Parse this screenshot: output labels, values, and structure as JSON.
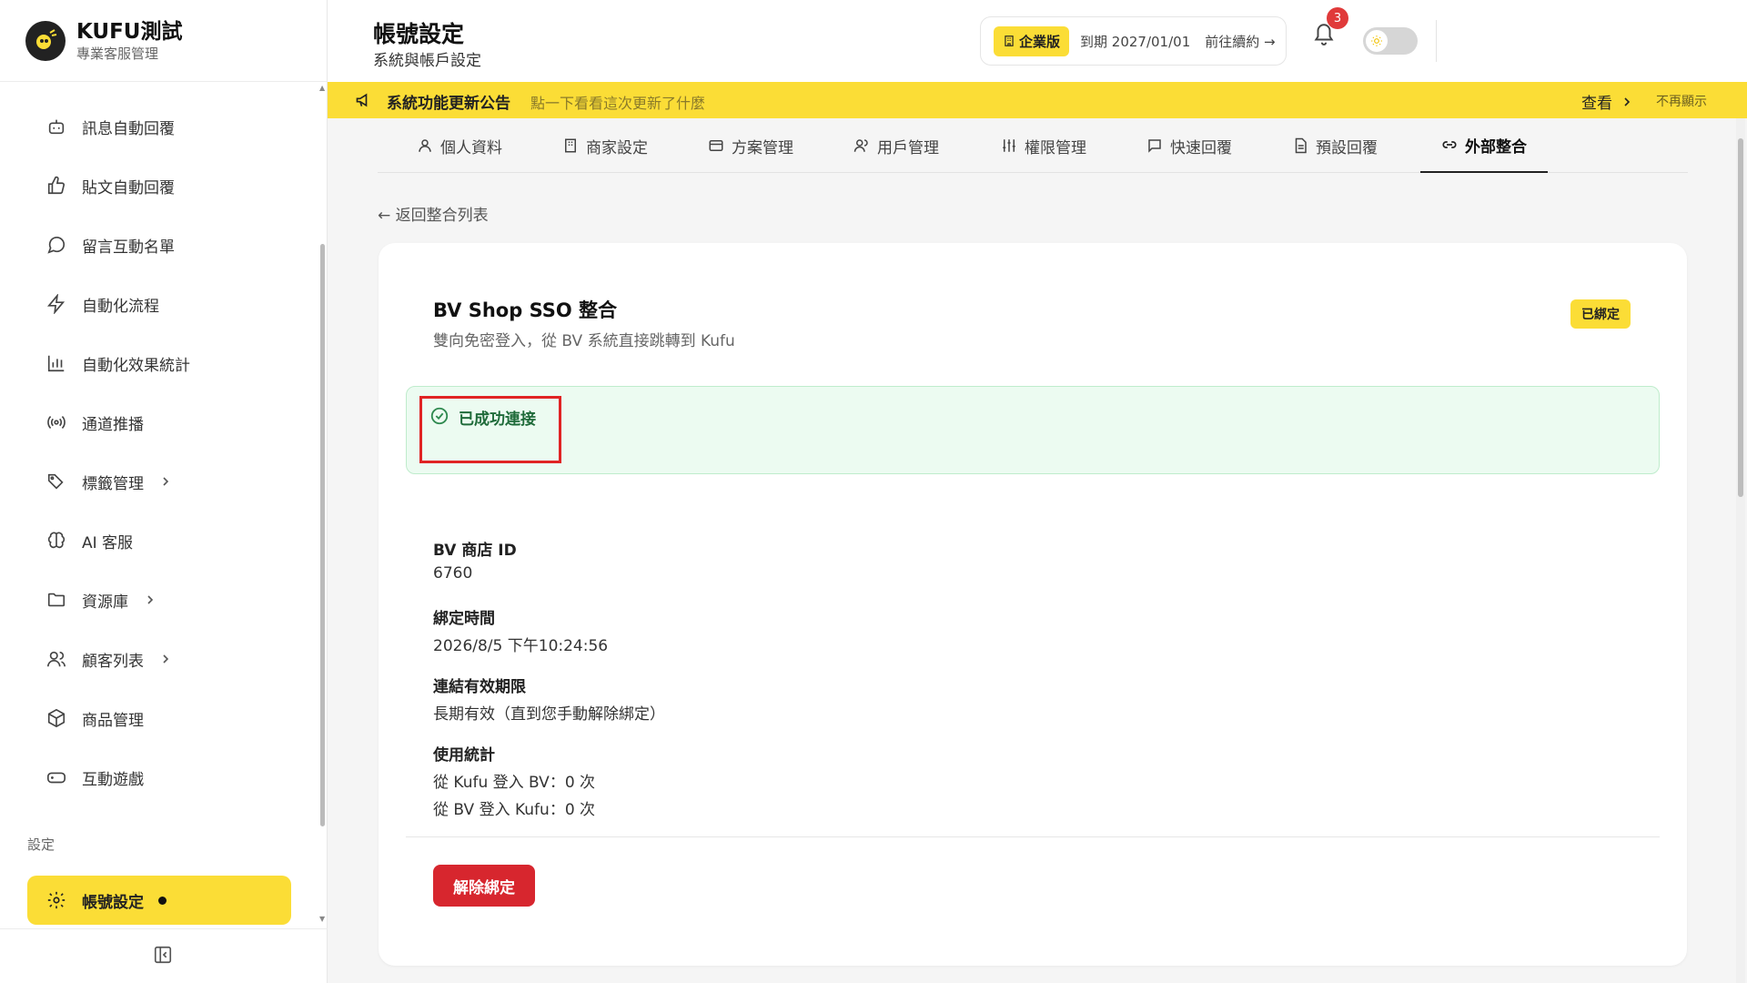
{
  "brand": {
    "name": "KUFU測試",
    "subtitle": "專業客服管理"
  },
  "sidebar": {
    "items": [
      {
        "label": "訊息自動回覆",
        "icon": "bot-icon"
      },
      {
        "label": "貼文自動回覆",
        "icon": "thumbs-up-icon"
      },
      {
        "label": "留言互動名單",
        "icon": "message-circle-icon"
      },
      {
        "label": "自動化流程",
        "icon": "zap-icon"
      },
      {
        "label": "自動化效果統計",
        "icon": "bar-chart-icon"
      },
      {
        "label": "通道推播",
        "icon": "broadcast-icon"
      },
      {
        "label": "標籤管理",
        "icon": "tags-icon"
      },
      {
        "label": "AI 客服",
        "icon": "brain-icon"
      },
      {
        "label": "資源庫",
        "icon": "folder-icon"
      },
      {
        "label": "顧客列表",
        "icon": "users-icon"
      },
      {
        "label": "商品管理",
        "icon": "package-icon"
      },
      {
        "label": "互動遊戲",
        "icon": "gamepad-icon"
      }
    ],
    "section_label": "設定",
    "active_item": "帳號設定"
  },
  "header": {
    "title": "帳號設定",
    "subtitle": "系統與帳戶設定",
    "plan_badge": "企業版",
    "plan_expire": "到期 2027/01/01",
    "plan_renew": "前往續約 →",
    "notification_count": "3"
  },
  "announcement": {
    "title": "系統功能更新公告",
    "text": "點一下看看這次更新了什麼",
    "view": "查看",
    "dismiss": "不再顯示"
  },
  "tabs": [
    {
      "label": "個人資料",
      "icon": "user-icon"
    },
    {
      "label": "商家設定",
      "icon": "building-icon"
    },
    {
      "label": "方案管理",
      "icon": "credit-card-icon"
    },
    {
      "label": "用戶管理",
      "icon": "users-icon"
    },
    {
      "label": "權限管理",
      "icon": "sliders-icon"
    },
    {
      "label": "快速回覆",
      "icon": "message-square-icon"
    },
    {
      "label": "預設回覆",
      "icon": "file-text-icon"
    },
    {
      "label": "外部整合",
      "icon": "link-icon"
    }
  ],
  "back_link": "← 返回整合列表",
  "card": {
    "title": "BV Shop SSO 整合",
    "description": "雙向免密登入，從 BV 系統直接跳轉到 Kufu",
    "badge": "已綁定",
    "status": "已成功連接",
    "fields": [
      {
        "label": "BV 商店 ID",
        "values": [
          "6760"
        ]
      },
      {
        "label": "綁定時間",
        "values": [
          "2026/8/5 下午10:24:56"
        ]
      },
      {
        "label": "連結有效期限",
        "values": [
          "長期有效（直到您手動解除綁定）"
        ]
      },
      {
        "label": "使用統計",
        "values": [
          "從 Kufu 登入 BV：0 次",
          "從 BV 登入 Kufu：0 次"
        ]
      }
    ],
    "unbind_button": "解除綁定"
  },
  "colors": {
    "accent": "#fbdd36",
    "danger": "#d7262e",
    "success_bg": "#ecfbf1",
    "success_text": "#1f6b3a"
  }
}
